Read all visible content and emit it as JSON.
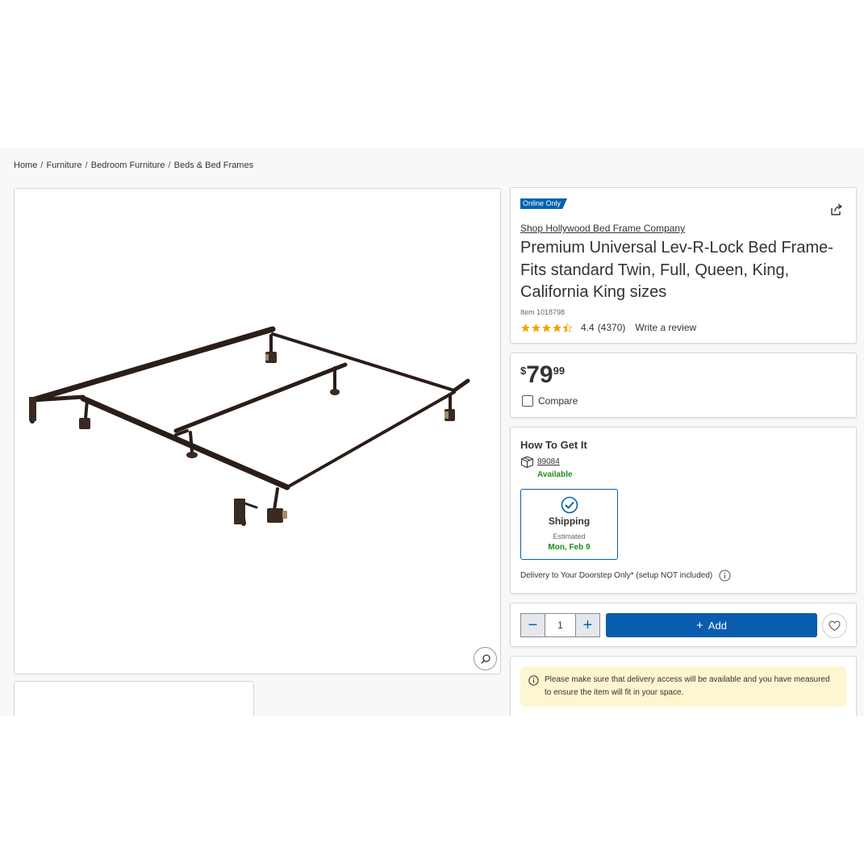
{
  "breadcrumb": {
    "items": [
      "Home",
      "Furniture",
      "Bedroom Furniture",
      "Beds & Bed Frames"
    ],
    "separator": "/"
  },
  "gallery": {
    "image_subject": "metal bed frame",
    "zoom_icon": "magnifier-icon"
  },
  "product": {
    "badge": "Online Only",
    "brand": "Shop Hollywood Bed Frame Company",
    "title": "Premium Universal Lev-R-Lock Bed Frame- Fits standard Twin, Full, Queen, King, California King sizes",
    "item_number": "Item 1018798",
    "rating": "4.4",
    "rating_value": 4.4,
    "review_count": "(4370)",
    "write_review": "Write a review",
    "share_icon": "share-icon"
  },
  "price": {
    "currency": "$",
    "dollars": "79",
    "cents": "99",
    "compare_label": "Compare"
  },
  "fulfillment": {
    "title": "How To Get It",
    "zip": "89084",
    "availability": "Available",
    "shipping_label": "Shipping",
    "estimated_label": "Estimated",
    "estimated_date": "Mon, Feb 9",
    "delivery_note": "Delivery to Your Doorstep Only* (setup NOT included)"
  },
  "cart": {
    "quantity": "1",
    "add_label": "Add",
    "add_plus": "+",
    "minus": "−",
    "plus": "+"
  },
  "notice": {
    "text": "Please make sure that delivery access will be available and you have measured to ensure the item will fit in your space."
  },
  "colors": {
    "accent_blue": "#0061b0",
    "available_green": "#218a21",
    "notice_bg": "#fdf6cf",
    "star_gold": "#f0a500"
  }
}
